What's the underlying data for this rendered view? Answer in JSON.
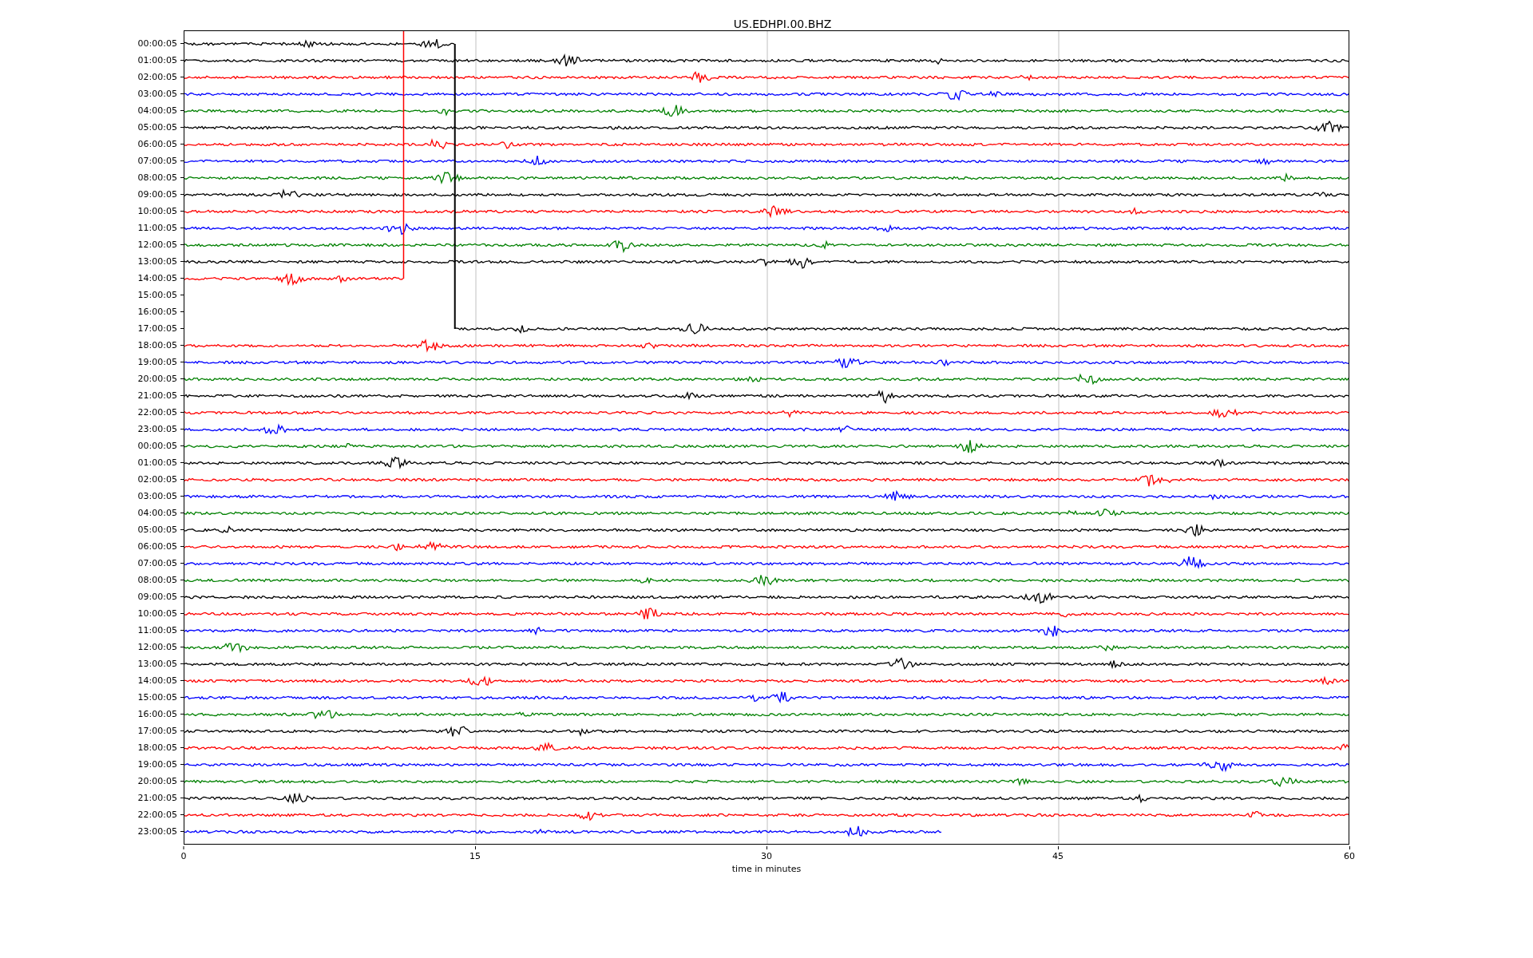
{
  "title": "US.EDHPI.00.BHZ",
  "rows": [
    {
      "label": "00:00:05",
      "color": "#000000"
    },
    {
      "label": "01:00:05",
      "color": "#000000"
    },
    {
      "label": "02:00:05",
      "color": "#ff0000"
    },
    {
      "label": "03:00:05",
      "color": "#0000ff"
    },
    {
      "label": "04:00:05",
      "color": "#008000"
    },
    {
      "label": "05:00:05",
      "color": "#000000"
    },
    {
      "label": "06:00:05",
      "color": "#ff0000"
    },
    {
      "label": "07:00:05",
      "color": "#0000ff"
    },
    {
      "label": "08:00:05",
      "color": "#008000"
    },
    {
      "label": "09:00:05",
      "color": "#000000"
    },
    {
      "label": "10:00:05",
      "color": "#ff0000"
    },
    {
      "label": "11:00:05",
      "color": "#0000ff"
    },
    {
      "label": "12:00:05",
      "color": "#008000"
    },
    {
      "label": "13:00:05",
      "color": "#000000"
    },
    {
      "label": "14:00:05",
      "color": "#ff0000"
    },
    {
      "label": "15:00:05"
    },
    {
      "label": "16:00:05"
    },
    {
      "label": "17:00:05",
      "color": "#000000"
    },
    {
      "label": "18:00:05",
      "color": "#ff0000"
    },
    {
      "label": "19:00:05",
      "color": "#0000ff"
    },
    {
      "label": "20:00:05",
      "color": "#008000"
    },
    {
      "label": "21:00:05",
      "color": "#000000"
    },
    {
      "label": "22:00:05",
      "color": "#ff0000"
    },
    {
      "label": "23:00:05",
      "color": "#0000ff"
    },
    {
      "label": "00:00:05",
      "color": "#008000"
    },
    {
      "label": "01:00:05",
      "color": "#000000"
    },
    {
      "label": "02:00:05",
      "color": "#ff0000"
    },
    {
      "label": "03:00:05",
      "color": "#0000ff"
    },
    {
      "label": "04:00:05",
      "color": "#008000"
    },
    {
      "label": "05:00:05",
      "color": "#000000"
    },
    {
      "label": "06:00:05",
      "color": "#ff0000"
    },
    {
      "label": "07:00:05",
      "color": "#0000ff"
    },
    {
      "label": "08:00:05",
      "color": "#008000"
    },
    {
      "label": "09:00:05",
      "color": "#000000"
    },
    {
      "label": "10:00:05",
      "color": "#ff0000"
    },
    {
      "label": "11:00:05",
      "color": "#0000ff"
    },
    {
      "label": "12:00:05",
      "color": "#008000"
    },
    {
      "label": "13:00:05",
      "color": "#000000"
    },
    {
      "label": "14:00:05",
      "color": "#ff0000"
    },
    {
      "label": "15:00:05",
      "color": "#0000ff"
    },
    {
      "label": "16:00:05",
      "color": "#008000"
    },
    {
      "label": "17:00:05",
      "color": "#000000"
    },
    {
      "label": "18:00:05",
      "color": "#ff0000"
    },
    {
      "label": "19:00:05",
      "color": "#0000ff"
    },
    {
      "label": "20:00:05",
      "color": "#008000"
    },
    {
      "label": "21:00:05",
      "color": "#000000"
    },
    {
      "label": "22:00:05",
      "color": "#ff0000"
    },
    {
      "label": "23:00:05",
      "color": "#0000ff"
    }
  ],
  "x_axis": {
    "ticks": [
      "0",
      "15",
      "30",
      "45",
      "60"
    ],
    "label": "time in minutes"
  }
}
